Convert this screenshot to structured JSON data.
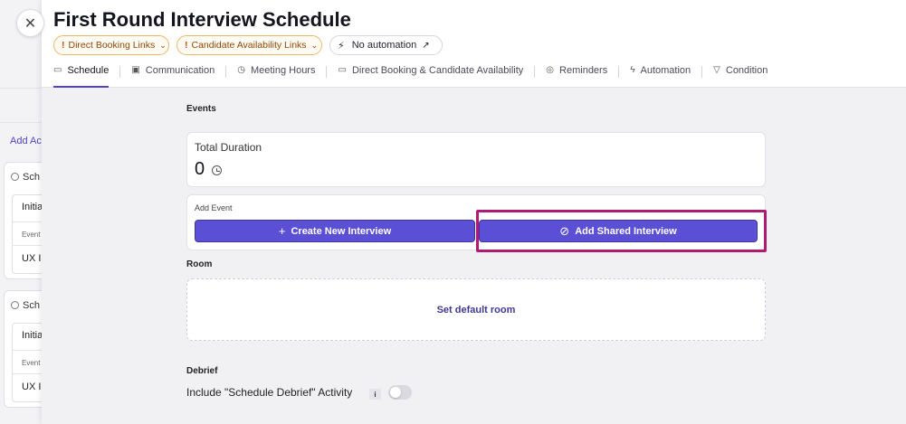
{
  "background": {
    "add_link": "Add Ac",
    "cards": [
      {
        "header": "Sch",
        "title": "Initia",
        "sub": "Event",
        "item": "UX Ir"
      },
      {
        "header": "Sch",
        "title": "Initia",
        "sub": "Event",
        "item": "UX Ir"
      }
    ]
  },
  "close_icon": "✕",
  "header": {
    "title": "First Round Interview Schedule",
    "chips": [
      {
        "label": "Direct Booking Links",
        "icon": "!",
        "chevron": "⌄"
      },
      {
        "label": "Candidate Availability Links",
        "icon": "!",
        "chevron": "⌄"
      },
      {
        "label": "No automation",
        "icon": "automation-off-icon",
        "arrow": "↗"
      }
    ],
    "tabs": [
      {
        "label": "Schedule",
        "icon": "calendar-icon",
        "glyph": "▭"
      },
      {
        "label": "Communication",
        "icon": "message-icon",
        "glyph": "▣"
      },
      {
        "label": "Meeting Hours",
        "icon": "clock-icon",
        "glyph": "◷"
      },
      {
        "label": "Direct Booking & Candidate Availability",
        "icon": "calendar-icon",
        "glyph": "▭"
      },
      {
        "label": "Reminders",
        "icon": "alarm-icon",
        "glyph": "◎"
      },
      {
        "label": "Automation",
        "icon": "lightning-icon",
        "glyph": "ϟ"
      },
      {
        "label": "Condition",
        "icon": "filter-icon",
        "glyph": "▽"
      }
    ]
  },
  "events": {
    "section_label": "Events",
    "total_duration_label": "Total Duration",
    "total_duration_value": "0",
    "add_event_label": "Add Event",
    "create_button": "Create New Interview",
    "create_icon": "+",
    "shared_button": "Add Shared Interview",
    "shared_icon": "⊘"
  },
  "room": {
    "section_label": "Room",
    "set_default": "Set default room"
  },
  "debrief": {
    "section_label": "Debrief",
    "include_label": "Include \"Schedule Debrief\" Activity",
    "info": "i",
    "toggle_on": false
  },
  "colors": {
    "accent": "#5b4fd6",
    "highlight": "#b01a72",
    "warning": "#d04a0c"
  }
}
